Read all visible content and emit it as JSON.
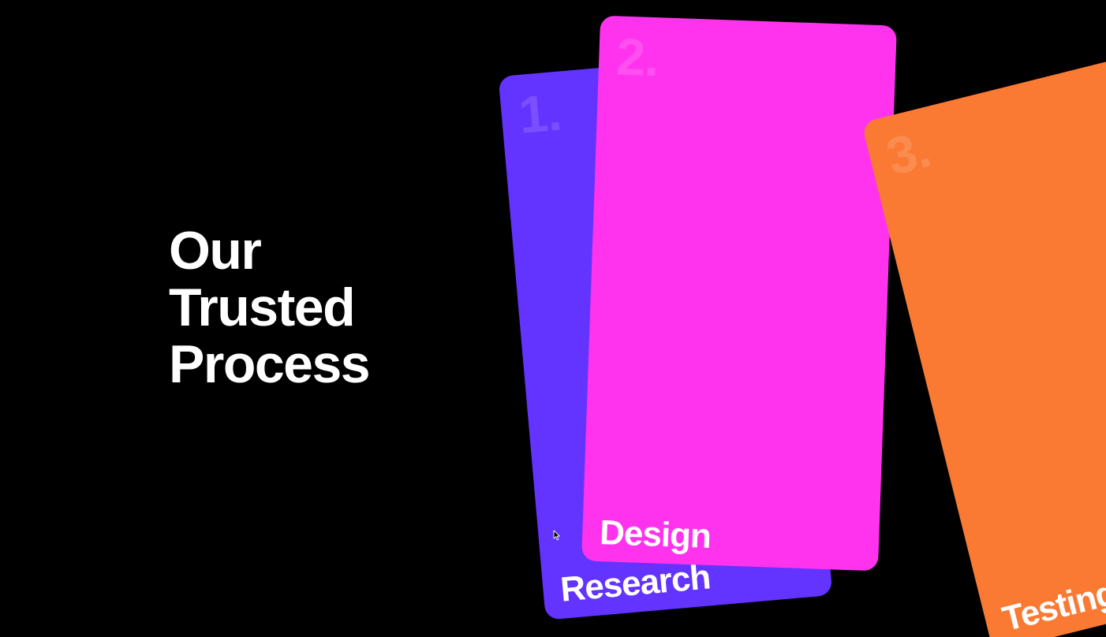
{
  "heading": {
    "line1": "Our",
    "line2": "Trusted",
    "line3": "Process"
  },
  "cards": [
    {
      "number": "1.",
      "title": "Research",
      "color": "#6333ff"
    },
    {
      "number": "2.",
      "title": "Design",
      "color": "#ff33ee"
    },
    {
      "number": "3.",
      "title": "Testing",
      "color": "#fb7a33"
    }
  ],
  "colors": {
    "background": "#000000",
    "text": "#ffffff"
  },
  "cursor": "arrow-cursor-icon"
}
